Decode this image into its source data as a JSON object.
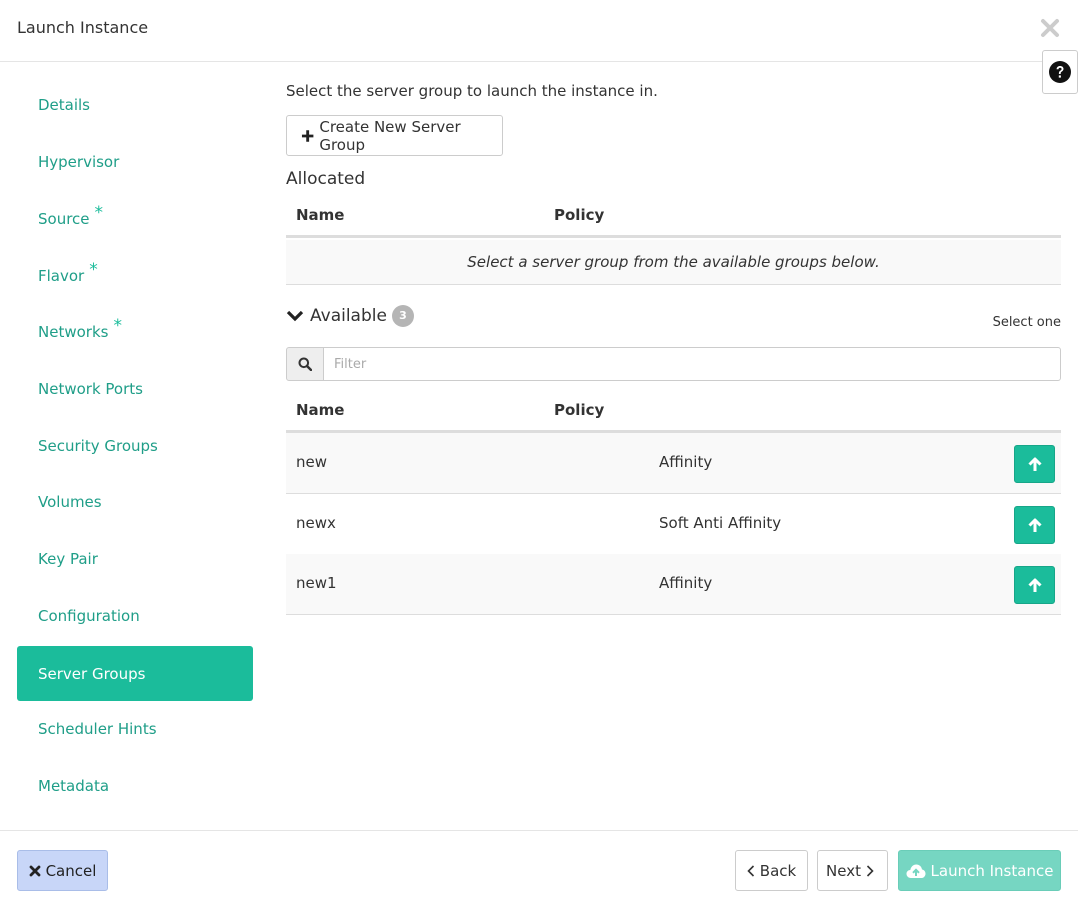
{
  "modal": {
    "title": "Launch Instance"
  },
  "nav": {
    "items": [
      {
        "label": "Details",
        "required": ""
      },
      {
        "label": "Hypervisor",
        "required": ""
      },
      {
        "label": "Source",
        "required": "*"
      },
      {
        "label": "Flavor",
        "required": "*"
      },
      {
        "label": "Networks",
        "required": "*"
      },
      {
        "label": "Network Ports",
        "required": ""
      },
      {
        "label": "Security Groups",
        "required": ""
      },
      {
        "label": "Volumes",
        "required": ""
      },
      {
        "label": "Key Pair",
        "required": ""
      },
      {
        "label": "Configuration",
        "required": ""
      },
      {
        "label": "Server Groups",
        "required": ""
      },
      {
        "label": "Scheduler Hints",
        "required": ""
      },
      {
        "label": "Metadata",
        "required": ""
      }
    ],
    "active": "Server Groups"
  },
  "main": {
    "intro": "Select the server group to launch the instance in.",
    "create_button": "Create New Server Group",
    "allocated": {
      "title": "Allocated",
      "columns": [
        "Name",
        "Policy"
      ],
      "empty_message": "Select a server group from the available groups below."
    },
    "available": {
      "title": "Available",
      "count": "3",
      "hint": "Select one",
      "filter_placeholder": "Filter",
      "columns": [
        "Name",
        "Policy"
      ],
      "rows": [
        {
          "name": "new",
          "policy": "Affinity"
        },
        {
          "name": "newx",
          "policy": "Soft Anti Affinity"
        },
        {
          "name": "new1",
          "policy": "Affinity"
        }
      ]
    }
  },
  "footer": {
    "cancel": "Cancel",
    "back": "Back",
    "next": "Next",
    "launch": "Launch Instance"
  },
  "colors": {
    "accent": "#1bbc9b",
    "nav_link": "#1f9e88",
    "cancel_bg": "#c8d6f8",
    "launch_disabled_bg": "#76d6c2"
  },
  "icons": {
    "close": "times-icon",
    "help": "question-circle-icon",
    "create": "plus-icon",
    "available_toggle": "chevron-down-icon",
    "filter": "search-icon",
    "allocate": "arrow-up-icon",
    "cancel": "times-icon",
    "back": "chevron-left-icon",
    "next": "chevron-right-icon",
    "launch": "cloud-upload-icon"
  }
}
